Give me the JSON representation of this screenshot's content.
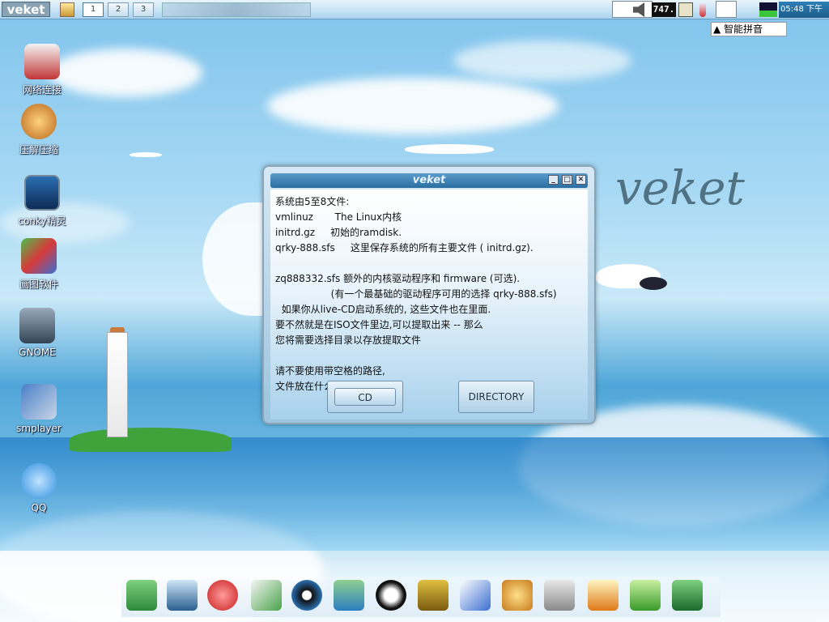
{
  "topbar": {
    "logo": "veket",
    "workspaces": [
      "1",
      "2",
      "3"
    ],
    "cpu": "747.",
    "clock": "05:48  下午"
  },
  "ime": {
    "label": "智能拼音"
  },
  "desktop_icons": [
    {
      "label": "网络连接",
      "icon": "network-icon"
    },
    {
      "label": "压解压缩",
      "icon": "archive-icon"
    },
    {
      "label": "conky精灵",
      "icon": "conky-icon"
    },
    {
      "label": "画图软件",
      "icon": "paint-icon"
    },
    {
      "label": "GNOME",
      "icon": "gnome-icon"
    },
    {
      "label": "smplayer",
      "icon": "smplayer-icon"
    },
    {
      "label": "QQ",
      "icon": "qq-icon"
    }
  ],
  "dialog": {
    "title": "veket",
    "body": "系统由5至8文件:\nvmlinuz       The Linux内核\ninitrd.gz     初始的ramdisk.\nqrky-888.sfs     这里保存系统的所有主要文件 ( initrd.gz).\n\nzq888332.sfs 额外的内核驱动程序和 firmware (可选).\n                  (有一个最基础的驱动程序可用的选择 qrky-888.sfs)\n  如果你从live-CD启动系统的, 这些文件也在里面.\n要不然就是在ISO文件里边,可以提取出来 -- 那么\n您将需要选择目录以存放提取文件\n\n请不要使用带空格的路径,\n文件放在什么地方?...",
    "buttons": {
      "cd": "CD",
      "directory": "DIRECTORY"
    }
  },
  "background_text": "veket",
  "dock_items": [
    "file-manager-icon",
    "terminal-icon",
    "pet-icon",
    "editor-icon",
    "media-icon",
    "messenger-icon",
    "qq-penguin-icon",
    "notebook-icon",
    "chart-icon",
    "paint-icon",
    "usb-icon",
    "photo-icon",
    "help-icon",
    "camera-icon"
  ]
}
